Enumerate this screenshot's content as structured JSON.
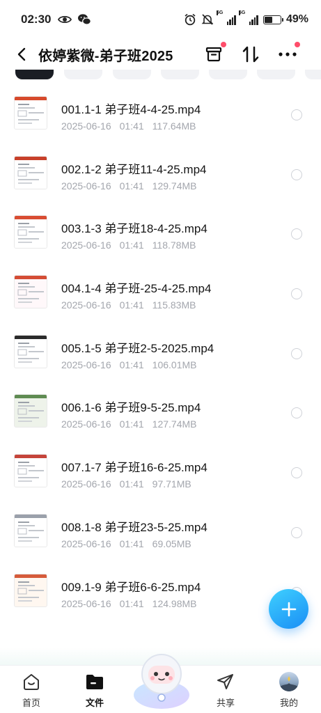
{
  "status_bar": {
    "time": "02:30",
    "network_label_1": "5G",
    "network_label_2": "5G",
    "battery": "49%",
    "battery_level": 0.49
  },
  "header": {
    "title": "依婷紫微-弟子班2025",
    "back_icon": "back-arrow-icon",
    "icons": [
      "archive-icon",
      "sort-icon",
      "more-icon"
    ]
  },
  "files": [
    {
      "name": "001.1-1 弟子班4-4-25.mp4",
      "date": "2025-06-16",
      "time": "01:41",
      "size": "117.64MB"
    },
    {
      "name": "002.1-2 弟子班11-4-25.mp4",
      "date": "2025-06-16",
      "time": "01:41",
      "size": "129.74MB"
    },
    {
      "name": "003.1-3 弟子班18-4-25.mp4",
      "date": "2025-06-16",
      "time": "01:41",
      "size": "118.78MB"
    },
    {
      "name": "004.1-4 弟子班-25-4-25.mp4",
      "date": "2025-06-16",
      "time": "01:41",
      "size": "115.83MB"
    },
    {
      "name": "005.1-5 弟子班2-5-2025.mp4",
      "date": "2025-06-16",
      "time": "01:41",
      "size": "106.01MB"
    },
    {
      "name": "006.1-6 弟子班9-5-25.mp4",
      "date": "2025-06-16",
      "time": "01:41",
      "size": "127.74MB"
    },
    {
      "name": "007.1-7 弟子班16-6-25.mp4",
      "date": "2025-06-16",
      "time": "01:41",
      "size": "97.71MB"
    },
    {
      "name": "008.1-8 弟子班23-5-25.mp4",
      "date": "2025-06-16",
      "time": "01:41",
      "size": "69.05MB"
    },
    {
      "name": "009.1-9 弟子班6-6-25.mp4",
      "date": "2025-06-16",
      "time": "01:41",
      "size": "124.98MB"
    }
  ],
  "fab": {
    "icon": "plus-icon"
  },
  "tabbar": {
    "tabs": [
      {
        "label": "首页",
        "icon": "home-icon"
      },
      {
        "label": "文件",
        "icon": "folder-icon",
        "active": true
      },
      {
        "label": "共享",
        "icon": "send-icon"
      },
      {
        "label": "我的",
        "icon": "avatar-icon"
      }
    ]
  },
  "colors": {
    "accent": "#1a8ef5",
    "badge": "#ff4d6a",
    "meta_text": "#a3a6ad"
  }
}
